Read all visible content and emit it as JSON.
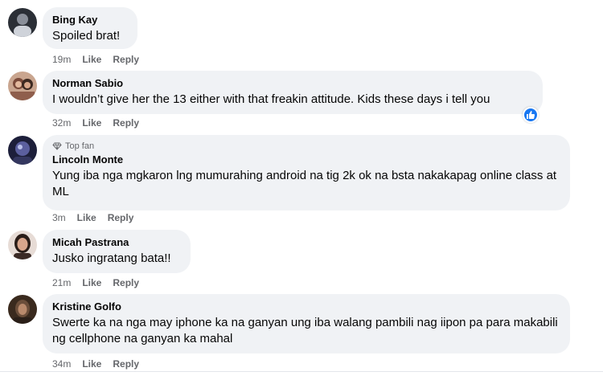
{
  "comments": [
    {
      "author": "Bing Kay",
      "text": "Spoiled brat!",
      "time": "19m",
      "like": "Like",
      "reply": "Reply"
    },
    {
      "author": "Norman Sabio",
      "text": "I wouldn’t give her the 13 either with that freakin attitude. Kids these days i tell you",
      "time": "32m",
      "like": "Like",
      "reply": "Reply"
    },
    {
      "badge": "Top fan",
      "author": "Lincoln Monte",
      "text": "Yung iba nga mgkaron lng mumurahing android na tig 2k ok na bsta nakakapag online class at ML",
      "time": "3m",
      "like": "Like",
      "reply": "Reply"
    },
    {
      "author": "Micah Pastrana",
      "text": "Jusko ingratang bata!!",
      "time": "21m",
      "like": "Like",
      "reply": "Reply"
    },
    {
      "author": "Kristine Golfo",
      "text": "Swerte ka na nga may iphone ka na ganyan ung iba walang pambili nag iipon pa para makabili ng cellphone na ganyan ka mahal",
      "time": "34m",
      "like": "Like",
      "reply": "Reply"
    }
  ],
  "colors": {
    "bubble": "#f0f2f5",
    "meta": "#65676b",
    "like_reaction": "#1877f2"
  }
}
